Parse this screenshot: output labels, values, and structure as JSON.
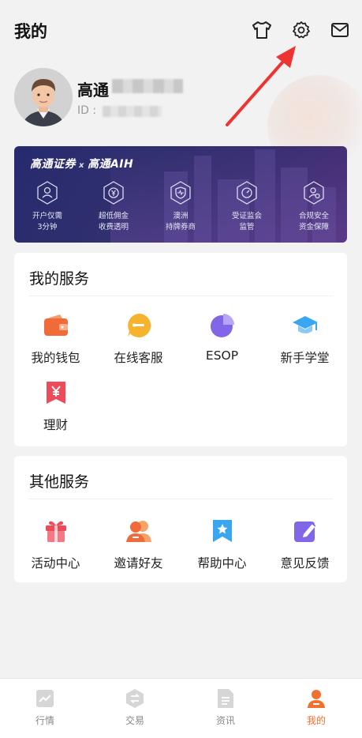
{
  "header": {
    "title": "我的",
    "icons": [
      "tshirt-icon",
      "settings-gear-icon",
      "mail-icon"
    ]
  },
  "profile": {
    "name": "高通",
    "id_label": "ID :"
  },
  "banner": {
    "brand_left": "高通证券",
    "brand_x": "x",
    "brand_right": "高通AIH",
    "features": [
      {
        "line1": "开户仅需",
        "line2": "3分钟",
        "icon": "user-hexagon-icon"
      },
      {
        "line1": "超低佣金",
        "line2": "收费透明",
        "icon": "yen-hexagon-icon"
      },
      {
        "line1": "澳洲",
        "line2": "持牌券商",
        "icon": "shield-hexagon-icon"
      },
      {
        "line1": "受证监会",
        "line2": "监管",
        "icon": "gauge-hexagon-icon"
      },
      {
        "line1": "合规安全",
        "line2": "资金保障",
        "icon": "person-check-hexagon-icon"
      }
    ]
  },
  "my_services": {
    "title": "我的服务",
    "items": [
      {
        "label": "我的钱包",
        "icon": "wallet-icon"
      },
      {
        "label": "在线客服",
        "icon": "chat-bubble-icon"
      },
      {
        "label": "ESOP",
        "icon": "pie-chart-icon"
      },
      {
        "label": "新手学堂",
        "icon": "graduation-cap-icon"
      },
      {
        "label": "理财",
        "icon": "yen-tag-icon"
      }
    ]
  },
  "other_services": {
    "title": "其他服务",
    "items": [
      {
        "label": "活动中心",
        "icon": "gift-icon"
      },
      {
        "label": "邀请好友",
        "icon": "invite-users-icon"
      },
      {
        "label": "帮助中心",
        "icon": "bookmark-star-icon"
      },
      {
        "label": "意见反馈",
        "icon": "edit-pen-icon"
      }
    ]
  },
  "tabbar": {
    "tabs": [
      {
        "label": "行情",
        "icon": "trend-chart-icon",
        "active": false
      },
      {
        "label": "交易",
        "icon": "exchange-hexagon-icon",
        "active": false
      },
      {
        "label": "资讯",
        "icon": "news-doc-icon",
        "active": false
      },
      {
        "label": "我的",
        "icon": "person-icon",
        "active": true
      }
    ]
  },
  "colors": {
    "accent": "#f07030",
    "banner": "#2c2d70",
    "background": "#f2f2f2"
  }
}
